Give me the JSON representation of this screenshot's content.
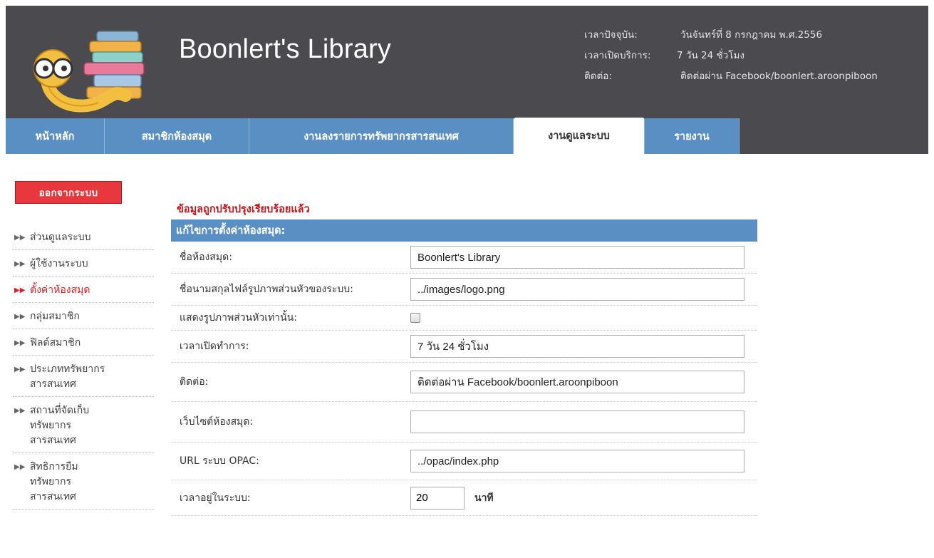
{
  "header": {
    "site_title": "Boonlert's Library",
    "info": [
      {
        "label": "เวลาปัจจุบัน:",
        "value": "วันจันทร์ที่ 8 กรกฎาคม พ.ศ.2556"
      },
      {
        "label": "เวลาเปิดบริการ:",
        "value": "7 วัน 24 ชั่วโมง"
      },
      {
        "label": "ติดต่อ:",
        "value": "ติดต่อผ่าน Facebook/boonlert.aroonpiboon"
      }
    ]
  },
  "nav": {
    "tabs": [
      {
        "label": "หน้าหลัก"
      },
      {
        "label": "สมาชิกห้องสมุด"
      },
      {
        "label": "งานลงรายการทรัพยากรสารสนเทศ"
      },
      {
        "label": "งานดูแลระบบ",
        "active": true
      },
      {
        "label": "รายงาน"
      }
    ]
  },
  "sidebar": {
    "logout_label": "ออกจากระบบ",
    "items": [
      {
        "label": "ส่วนดูแลระบบ"
      },
      {
        "label": "ผู้ใช้งานระบบ"
      },
      {
        "label": "ตั้งค่าห้องสมุด",
        "active": true
      },
      {
        "label": "กลุ่มสมาชิก"
      },
      {
        "label": "ฟิลด์สมาชิก"
      },
      {
        "label": "ประเภททรัพยากร\nสารสนเทศ"
      },
      {
        "label": "สถานที่จัดเก็บ\nทรัพยากร\nสารสนเทศ"
      },
      {
        "label": "สิทธิการยืม\nทรัพยากร\nสารสนเทศ"
      }
    ]
  },
  "main": {
    "status_message": "ข้อมูลถูกปรับปรุงเรียบร้อยแล้ว",
    "form_title": "แก้ไขการตั้งค่าห้องสมุด:",
    "fields": {
      "library_name": {
        "label": "ชื่อห้องสมุด:",
        "value": "Boonlert's Library"
      },
      "header_image": {
        "label": "ชื่อนามสกุลไฟล์รูปภาพส่วนหัวของระบบ:",
        "value": "../images/logo.png"
      },
      "header_only": {
        "label": "แสดงรูปภาพส่วนหัวเท่านั้น:",
        "checked": false
      },
      "opening_hours": {
        "label": "เวลาเปิดทำการ:",
        "value": "7 วัน 24 ชั่วโมง"
      },
      "contact": {
        "label": "ติดต่อ:",
        "value": "ติดต่อผ่าน Facebook/boonlert.aroonpiboon"
      },
      "website": {
        "label": "เว็บไซต์ห้องสมุด:",
        "value": ""
      },
      "opac_url": {
        "label": "URL ระบบ OPAC:",
        "value": "../opac/index.php"
      },
      "session_time": {
        "label": "เวลาอยู่ในระบบ:",
        "value": "20",
        "unit": "นาที"
      }
    }
  },
  "colors": {
    "header_bg": "#4a4a4f",
    "tab_blue": "#5a8fc3",
    "logout_red": "#e8383d",
    "status_red": "#c0161c"
  }
}
